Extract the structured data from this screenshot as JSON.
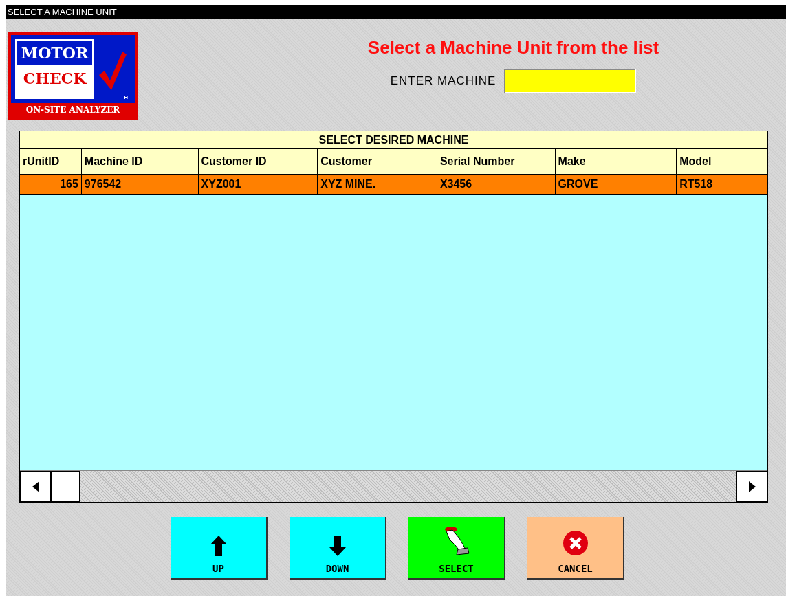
{
  "window": {
    "title": "SELECT A MACHINE UNIT"
  },
  "logo": {
    "line_1": "MOTOR",
    "line_2": "CHECK",
    "mark": "H",
    "tagline": "ON-SITE ANALYZER"
  },
  "heading": "Select a Machine Unit from the list",
  "machine_field": {
    "label": "ENTER MACHINE"
  },
  "table": {
    "title": "SELECT DESIRED MACHINE",
    "columns": [
      "rUnitID",
      "Machine ID",
      "Customer ID",
      "Customer",
      "Serial Number",
      "Make",
      "Model"
    ],
    "rows": [
      {
        "selected": true,
        "cells": [
          "165",
          "976542",
          "XYZ001",
          "XYZ MINE.",
          "X3456",
          "GROVE",
          "RT518"
        ]
      }
    ]
  },
  "buttons": [
    {
      "kind": "up",
      "label": "UP",
      "color": "#00ffff"
    },
    {
      "kind": "down",
      "label": "DOWN",
      "color": "#00ffff"
    },
    {
      "kind": "select",
      "label": "SELECT",
      "color": "#00ff00"
    },
    {
      "kind": "cancel",
      "label": "CANCEL",
      "color": "#ffc087"
    }
  ]
}
